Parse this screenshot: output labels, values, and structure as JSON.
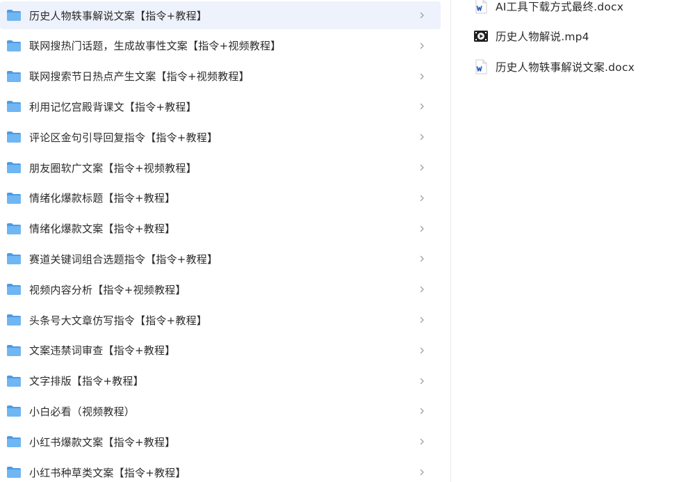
{
  "left_pane": {
    "folders": [
      {
        "label": "历史人物轶事解说文案【指令+教程】",
        "selected": true
      },
      {
        "label": "联网搜热门话题，生成故事性文案【指令+视频教程】",
        "selected": false
      },
      {
        "label": "联网搜索节日热点产生文案【指令+视频教程】",
        "selected": false
      },
      {
        "label": "利用记忆宫殿背课文【指令+教程】",
        "selected": false
      },
      {
        "label": "评论区金句引导回复指令【指令+教程】",
        "selected": false
      },
      {
        "label": "朋友圈软广文案【指令+视频教程】",
        "selected": false
      },
      {
        "label": "情绪化爆款标题【指令+教程】",
        "selected": false
      },
      {
        "label": "情绪化爆款文案【指令+教程】",
        "selected": false
      },
      {
        "label": "赛道关键词组合选题指令【指令+教程】",
        "selected": false
      },
      {
        "label": "视频内容分析【指令+视频教程】",
        "selected": false
      },
      {
        "label": "头条号大文章仿写指令【指令+教程】",
        "selected": false
      },
      {
        "label": "文案违禁词审查【指令+教程】",
        "selected": false
      },
      {
        "label": "文字排版【指令+教程】",
        "selected": false
      },
      {
        "label": "小白必看（视频教程）",
        "selected": false
      },
      {
        "label": "小红书爆款文案【指令+教程】",
        "selected": false
      },
      {
        "label": "小红书种草类文案【指令+教程】",
        "selected": false
      }
    ]
  },
  "right_pane": {
    "files": [
      {
        "label": "AI工具下载方式最终.docx",
        "icon": "word-doc-icon"
      },
      {
        "label": "历史人物解说.mp4",
        "icon": "video-file-icon"
      },
      {
        "label": "历史人物轶事解说文案.docx",
        "icon": "word-doc-icon"
      }
    ]
  },
  "colors": {
    "folder": "#6fb6f2",
    "folder_dark": "#4c9be4",
    "selected_bg": "#eef2fc",
    "text": "#2b2b2b",
    "chevron": "#9aa0a6",
    "word_blue": "#2b5fc4"
  }
}
